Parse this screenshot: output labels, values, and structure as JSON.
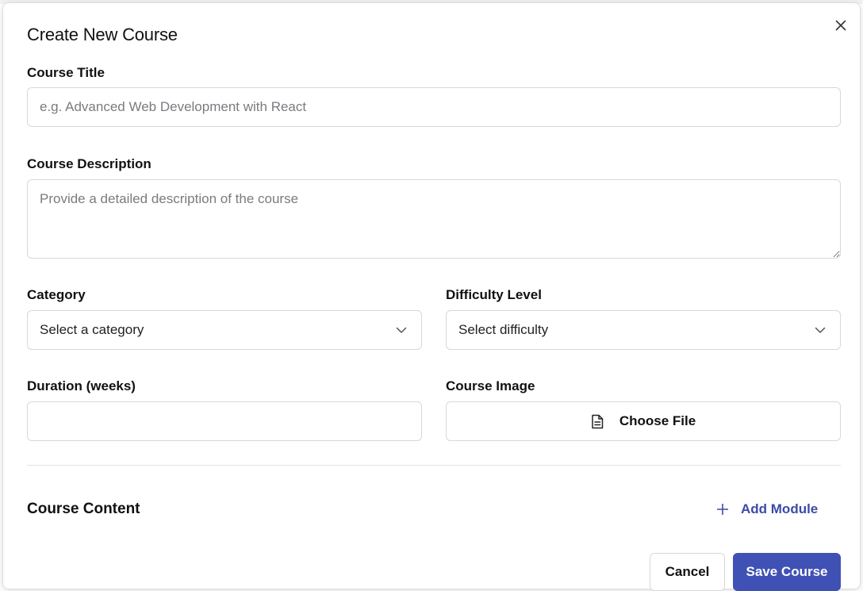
{
  "dialog": {
    "title": "Create New Course"
  },
  "fields": {
    "course_title": {
      "label": "Course Title",
      "placeholder": "e.g. Advanced Web Development with React",
      "value": ""
    },
    "course_description": {
      "label": "Course Description",
      "placeholder": "Provide a detailed description of the course",
      "value": ""
    },
    "category": {
      "label": "Category",
      "selected": "Select a category"
    },
    "difficulty": {
      "label": "Difficulty Level",
      "selected": "Select difficulty"
    },
    "duration": {
      "label": "Duration (weeks)",
      "value": ""
    },
    "course_image": {
      "label": "Course Image",
      "button_label": "Choose File"
    }
  },
  "content": {
    "section_title": "Course Content",
    "add_module_label": "Add Module"
  },
  "actions": {
    "cancel_label": "Cancel",
    "save_label": "Save Course"
  },
  "icons": {
    "close": "close-icon",
    "chevron": "chevron-down-icon",
    "file": "file-icon",
    "plus": "plus-icon"
  },
  "colors": {
    "primary": "#3f51b5",
    "link": "#3b4ba8",
    "border": "#d8d8dc",
    "placeholder": "#7b7b80"
  }
}
